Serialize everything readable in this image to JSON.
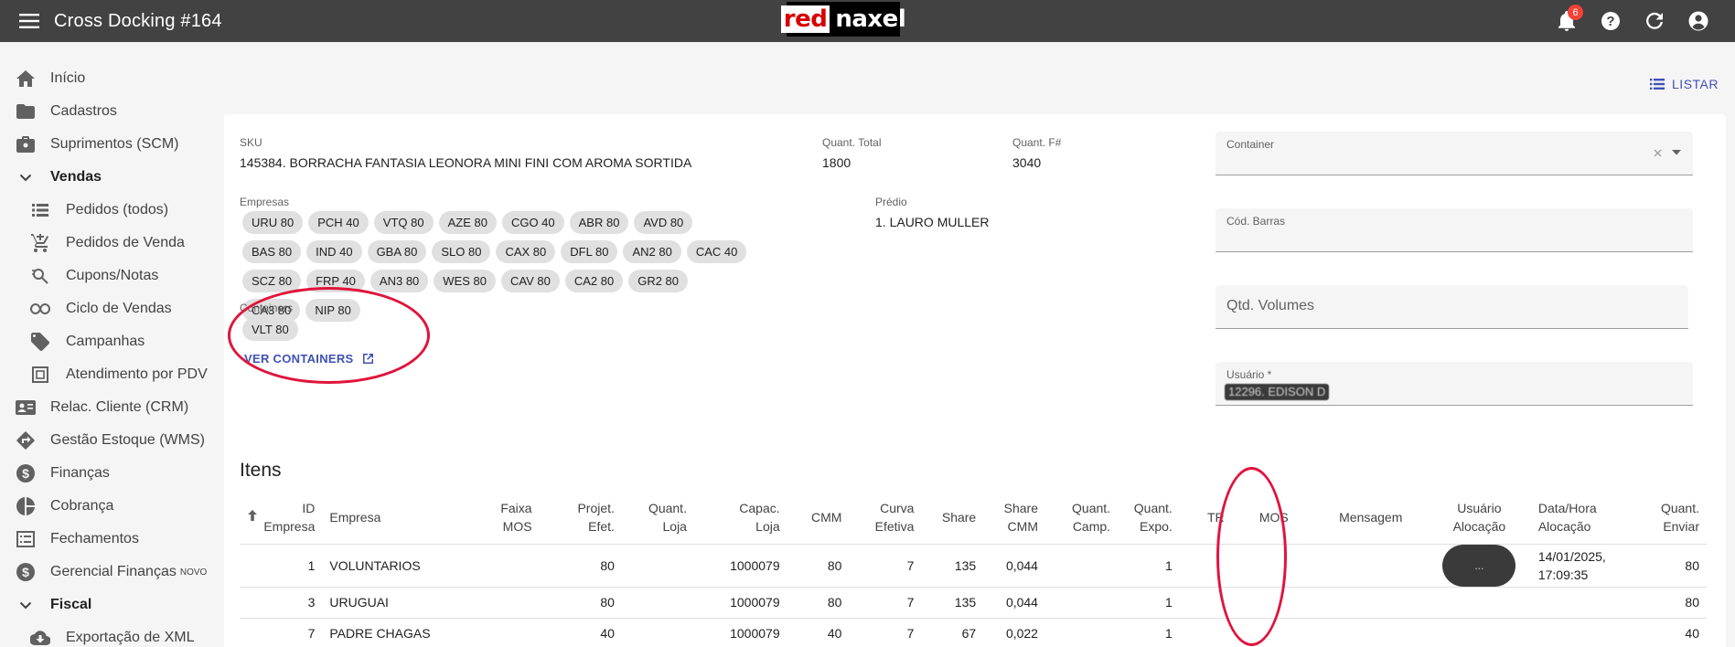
{
  "app": {
    "title": "Cross Docking #164",
    "logo_red": "red",
    "logo_rest": "naxel",
    "notifications_count": "6"
  },
  "sidebar": {
    "items": [
      {
        "label": "Início",
        "icon": "home-icon",
        "level": 0
      },
      {
        "label": "Cadastros",
        "icon": "folder-icon",
        "level": 0
      },
      {
        "label": "Suprimentos (SCM)",
        "icon": "briefcase-icon",
        "level": 0
      },
      {
        "label": "Vendas",
        "icon": "chevron-down-icon",
        "level": 0,
        "expanded": true
      },
      {
        "label": "Pedidos (todos)",
        "icon": "list-icon",
        "level": 1
      },
      {
        "label": "Pedidos de Venda",
        "icon": "cart-plus-icon",
        "level": 1
      },
      {
        "label": "Cupons/Notas",
        "icon": "receipt-search-icon",
        "level": 1
      },
      {
        "label": "Ciclo de Vendas",
        "icon": "infinity-icon",
        "level": 1
      },
      {
        "label": "Campanhas",
        "icon": "tag-icon",
        "level": 1
      },
      {
        "label": "Atendimento por PDV",
        "icon": "pdv-icon",
        "level": 1
      },
      {
        "label": "Relac. Cliente (CRM)",
        "icon": "contact-card-icon",
        "level": 0
      },
      {
        "label": "Gestão Estoque (WMS)",
        "icon": "directions-icon",
        "level": 0
      },
      {
        "label": "Finanças",
        "icon": "dollar-circle-icon",
        "level": 0
      },
      {
        "label": "Cobrança",
        "icon": "pie-icon",
        "level": 0
      },
      {
        "label": "Fechamentos",
        "icon": "list-alt-icon",
        "level": 0
      },
      {
        "label": "Gerencial Finanças",
        "icon": "dollar-circle-icon",
        "level": 0,
        "sup": "NOVO"
      },
      {
        "label": "Fiscal",
        "icon": "chevron-down-icon",
        "level": 0,
        "expanded": true
      },
      {
        "label": "Exportação de XML",
        "icon": "cloud-download-icon",
        "level": 1
      }
    ]
  },
  "header": {
    "listar_label": "LISTAR"
  },
  "form": {
    "sku_label": "SKU",
    "sku_value": "145384. BORRACHA FANTASIA LEONORA MINI FINI COM AROMA SORTIDA",
    "quant_total_label": "Quant. Total",
    "quant_total_value": "1800",
    "quant_f_label": "Quant. F#",
    "quant_f_value": "3040",
    "empresas_label": "Empresas",
    "empresas": [
      "URU 80",
      "PCH 40",
      "VTQ 80",
      "AZE 80",
      "CGO 40",
      "ABR 80",
      "AVD 80",
      "BAS 80",
      "IND 40",
      "GBA 80",
      "SLO 80",
      "CAX 80",
      "DFL 80",
      "AN2 80",
      "CAC 40",
      "SCZ 80",
      "FRP 40",
      "AN3 80",
      "WES 80",
      "CAV 80",
      "CA2 80",
      "GR2 80",
      "CA3 80",
      "NIP 80"
    ],
    "predio_label": "Prédio",
    "predio_value": "1. LAURO MULLER",
    "containers_label": "Containers",
    "containers": [
      "VLT 80"
    ],
    "ver_containers_label": "VER CONTAINERS",
    "container_field_label": "Container",
    "cod_barras_label": "Cód. Barras",
    "qtd_volumes_placeholder": "Qtd. Volumes",
    "usuario_label": "Usuário *",
    "usuario_value": "12296. EDISON D"
  },
  "itens": {
    "title": "Itens",
    "columns": [
      {
        "line1": "ID",
        "line2": "Empresa"
      },
      {
        "line1": "Empresa",
        "line2": ""
      },
      {
        "line1": "Faixa",
        "line2": "MOS"
      },
      {
        "line1": "Projet.",
        "line2": "Efet."
      },
      {
        "line1": "Quant.",
        "line2": "Loja"
      },
      {
        "line1": "Capac.",
        "line2": "Loja"
      },
      {
        "line1": "CMM",
        "line2": ""
      },
      {
        "line1": "Curva",
        "line2": "Efetiva"
      },
      {
        "line1": "Share",
        "line2": ""
      },
      {
        "line1": "Share",
        "line2": "CMM"
      },
      {
        "line1": "Quant.",
        "line2": "Camp."
      },
      {
        "line1": "Quant.",
        "line2": "Expo."
      },
      {
        "line1": "TR",
        "line2": ""
      },
      {
        "line1": "MOS",
        "line2": ""
      },
      {
        "line1": "Mensagem",
        "line2": ""
      },
      {
        "line1": "Usuário",
        "line2": "Alocação"
      },
      {
        "line1": "Data/Hora",
        "line2": "Alocação"
      },
      {
        "line1": "Quant.",
        "line2": "Enviar"
      }
    ],
    "rows": [
      {
        "id": "1",
        "empresa": "VOLUNTARIOS",
        "faixa": "",
        "projet": "80",
        "quant_loja": "",
        "capac": "1000079",
        "cmm": "80",
        "curva": "7",
        "share": "135",
        "share_cmm": "0,044",
        "camp": "",
        "expo": "1",
        "tr": "",
        "mos": "",
        "msg": "",
        "usuario": "...",
        "data_hora_1": "14/01/2025,",
        "data_hora_2": "17:09:35",
        "enviar": "80"
      },
      {
        "id": "3",
        "empresa": "URUGUAI",
        "faixa": "",
        "projet": "80",
        "quant_loja": "",
        "capac": "1000079",
        "cmm": "80",
        "curva": "7",
        "share": "135",
        "share_cmm": "0,044",
        "camp": "",
        "expo": "1",
        "tr": "",
        "mos": "",
        "msg": "",
        "usuario": "",
        "data_hora_1": "",
        "data_hora_2": "",
        "enviar": "80"
      },
      {
        "id": "7",
        "empresa": "PADRE CHAGAS",
        "faixa": "",
        "projet": "40",
        "quant_loja": "",
        "capac": "1000079",
        "cmm": "40",
        "curva": "7",
        "share": "67",
        "share_cmm": "0,022",
        "camp": "",
        "expo": "1",
        "tr": "",
        "mos": "",
        "msg": "",
        "usuario": "",
        "data_hora_1": "",
        "data_hora_2": "",
        "enviar": "40"
      }
    ]
  },
  "colors": {
    "topbar": "#424242",
    "accent": "#3f51b5",
    "annotation": "#e0143c",
    "badge": "#f44336"
  }
}
